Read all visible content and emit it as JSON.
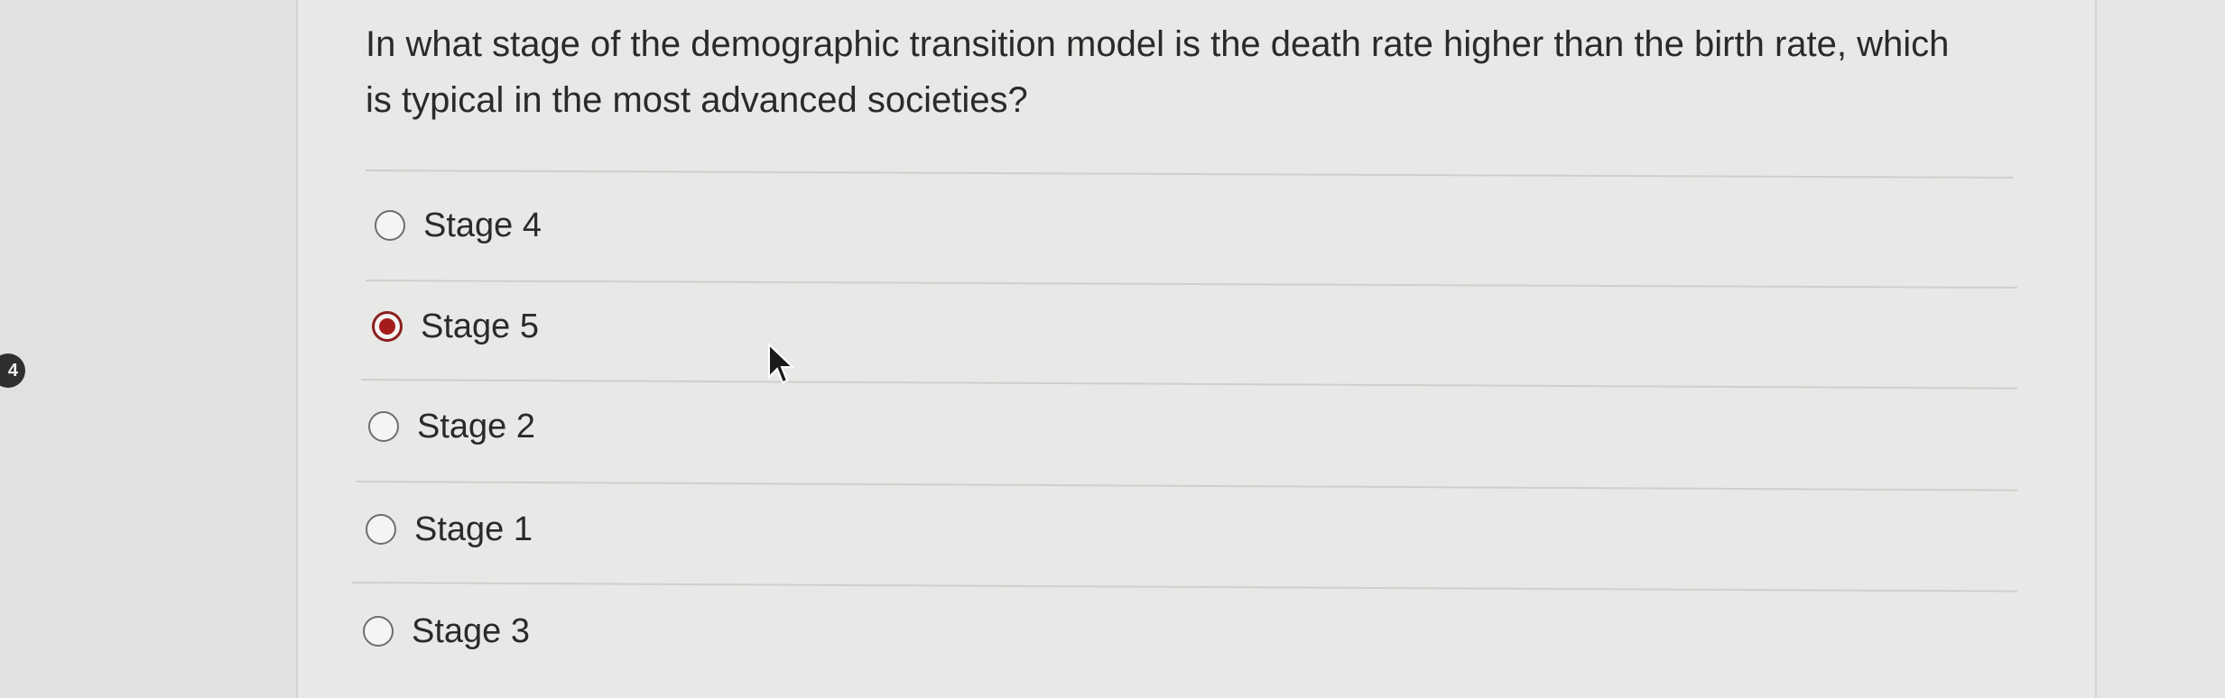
{
  "question": {
    "number": "4",
    "text": "In what stage of the demographic transition model is the death rate higher than the birth rate, which is typical in the most advanced societies?"
  },
  "options": [
    {
      "label": "Stage 4",
      "selected": false
    },
    {
      "label": "Stage 5",
      "selected": true
    },
    {
      "label": "Stage 2",
      "selected": false
    },
    {
      "label": "Stage 1",
      "selected": false
    },
    {
      "label": "Stage 3",
      "selected": false
    }
  ],
  "colors": {
    "selected_radio": "#a61c1c",
    "background": "#e8e8e6"
  }
}
